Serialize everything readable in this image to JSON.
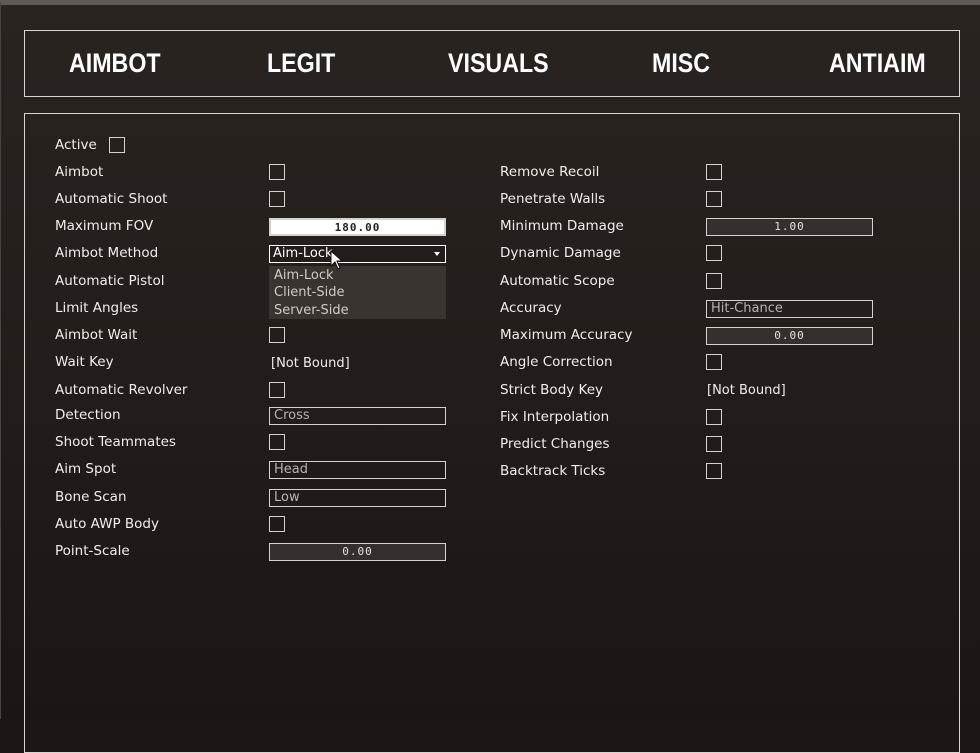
{
  "tabs": [
    "AIMBOT",
    "LEGIT",
    "VISUALS",
    "MISC",
    "ANTIAIM"
  ],
  "left": {
    "active": "Active",
    "aimbot": "Aimbot",
    "automatic_shoot": "Automatic Shoot",
    "maximum_fov": "Maximum FOV",
    "maximum_fov_value": "180.00",
    "aimbot_method": "Aimbot Method",
    "aimbot_method_value": "Aim-Lock",
    "aimbot_method_options": [
      "Aim-Lock",
      "Client-Side",
      "Server-Side"
    ],
    "automatic_pistol": "Automatic Pistol",
    "limit_angles": "Limit Angles",
    "aimbot_wait": "Aimbot Wait",
    "wait_key": "Wait Key",
    "wait_key_value": "[Not Bound]",
    "automatic_revolver": "Automatic Revolver",
    "detection": "Detection",
    "detection_value": "Cross",
    "shoot_teammates": "Shoot Teammates",
    "aim_spot": "Aim Spot",
    "aim_spot_value": "Head",
    "bone_scan": "Bone Scan",
    "bone_scan_value": "Low",
    "auto_awp_body": "Auto AWP Body",
    "point_scale": "Point-Scale",
    "point_scale_value": "0.00"
  },
  "right": {
    "remove_recoil": "Remove Recoil",
    "penetrate_walls": "Penetrate Walls",
    "minimum_damage": "Minimum Damage",
    "minimum_damage_value": "1.00",
    "dynamic_damage": "Dynamic Damage",
    "automatic_scope": "Automatic Scope",
    "accuracy": "Accuracy",
    "accuracy_value": "Hit-Chance",
    "maximum_accuracy": "Maximum Accuracy",
    "maximum_accuracy_value": "0.00",
    "angle_correction": "Angle Correction",
    "strict_body_key": "Strict Body Key",
    "strict_body_key_value": "[Not Bound]",
    "fix_interpolation": "Fix Interpolation",
    "predict_changes": "Predict Changes",
    "backtrack_ticks": "Backtrack Ticks"
  }
}
